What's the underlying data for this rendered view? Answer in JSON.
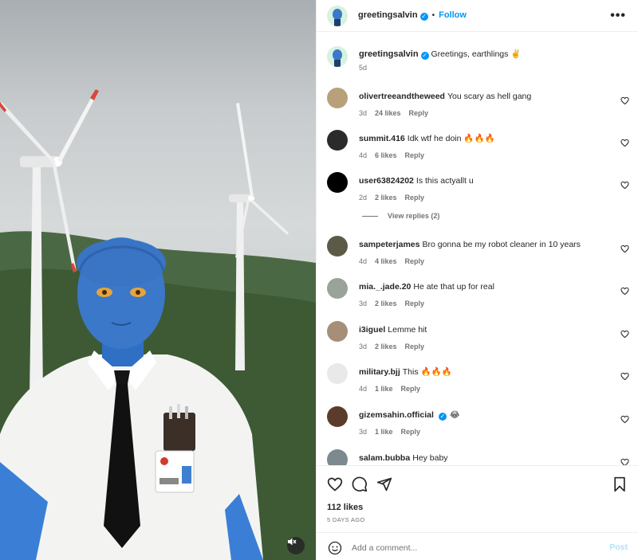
{
  "post": {
    "author": "greetingsalvin",
    "follow_label": "Follow",
    "separator": "•",
    "more_label": "•••",
    "caption_text": "Greetings, earthlings ✌️",
    "caption_time": "5d",
    "likes": "112 likes",
    "date": "5 DAYS AGO"
  },
  "comments": [
    {
      "user": "olivertreeandtheweed",
      "text": "You scary as hell gang",
      "time": "3d",
      "likes": "24 likes",
      "reply": "Reply",
      "verified": false,
      "avatar_color": "#b8a07a"
    },
    {
      "user": "summit.416",
      "text": "Idk wtf he doin 🔥🔥🔥",
      "time": "4d",
      "likes": "6 likes",
      "reply": "Reply",
      "verified": false,
      "avatar_color": "#2b2b2b"
    },
    {
      "user": "user63824202",
      "text": "Is this actyallt u",
      "time": "2d",
      "likes": "2 likes",
      "reply": "Reply",
      "verified": false,
      "avatar_color": "#000000"
    },
    {
      "user": "sampeterjames",
      "text": "Bro gonna be my robot cleaner in 10 years",
      "time": "4d",
      "likes": "4 likes",
      "reply": "Reply",
      "verified": false,
      "avatar_color": "#5c5a47"
    },
    {
      "user": "mia._.jade.20",
      "text": "He ate that up for real",
      "time": "3d",
      "likes": "2 likes",
      "reply": "Reply",
      "verified": false,
      "avatar_color": "#9aa39a"
    },
    {
      "user": "i3iguel",
      "text": "Lemme hit",
      "time": "3d",
      "likes": "2 likes",
      "reply": "Reply",
      "verified": false,
      "avatar_color": "#a68e78"
    },
    {
      "user": "military.bjj",
      "text": "This 🔥🔥🔥",
      "time": "4d",
      "likes": "1 like",
      "reply": "Reply",
      "verified": false,
      "avatar_color": "#e9e9e9"
    },
    {
      "user": "gizemsahin.official",
      "text": "😂",
      "time": "3d",
      "likes": "1 like",
      "reply": "Reply",
      "verified": true,
      "avatar_color": "#5a3b2c"
    },
    {
      "user": "salam.bubba",
      "text": "Hey baby",
      "time": "",
      "likes": "",
      "reply": "",
      "verified": false,
      "avatar_color": "#7c8a8f"
    }
  ],
  "view_replies": "View replies (2)",
  "add_comment": {
    "placeholder": "Add a comment...",
    "post_label": "Post"
  },
  "icons": {
    "like": "heart-icon",
    "comment": "comment-bubble-icon",
    "share": "paper-plane-icon",
    "save": "bookmark-icon",
    "emoji": "smiley-icon",
    "mute": "speaker-muted-icon",
    "more": "more-options-icon"
  },
  "colors": {
    "accent": "#0095f6",
    "text": "#262626",
    "muted": "#737373",
    "avatar_skin": "#3b78c9",
    "avatar_ring": "#d6f2e0"
  }
}
